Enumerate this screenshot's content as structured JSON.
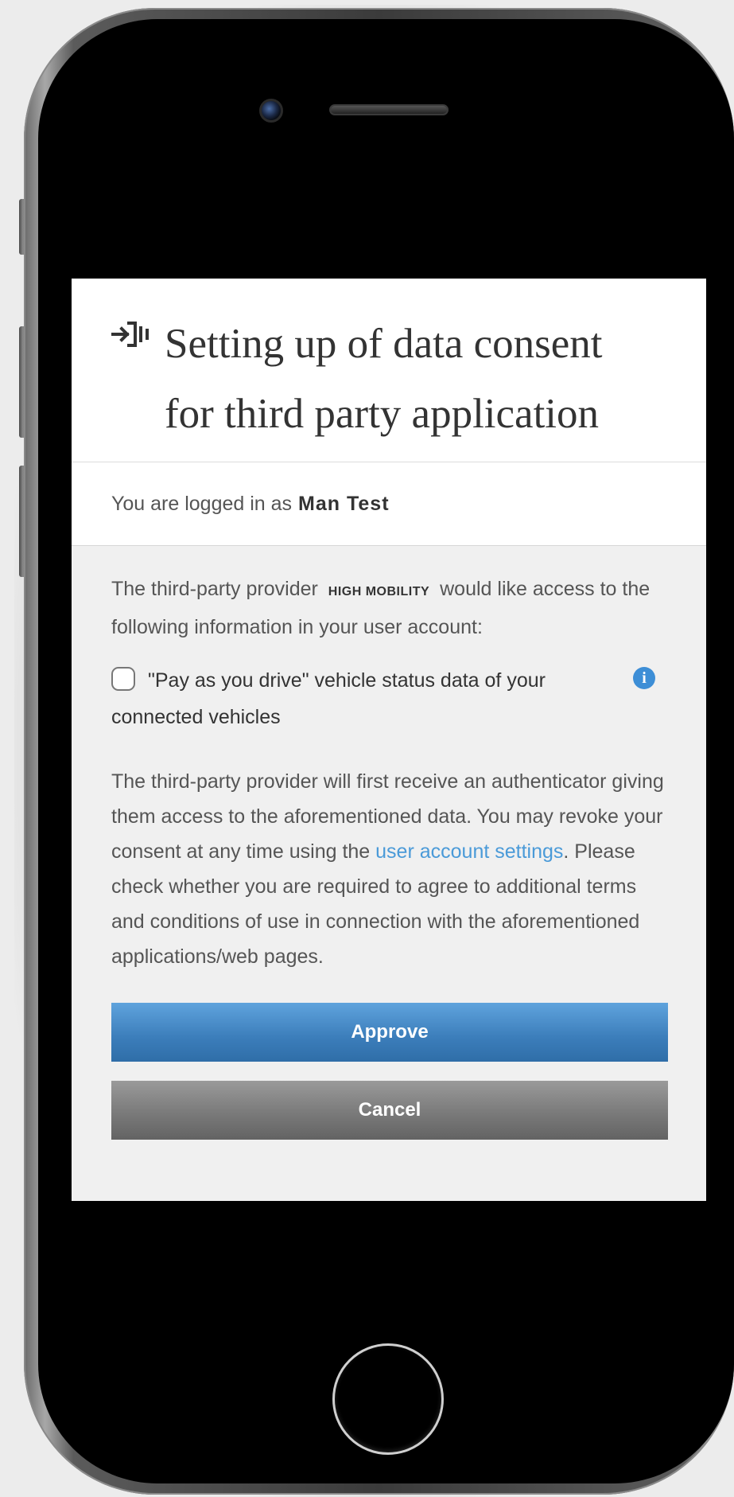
{
  "dialog": {
    "title_line1": "Setting up of data consent",
    "title_line2": "for third party application",
    "login_icon": "login-arrow-icon"
  },
  "account": {
    "logged_in_prefix": "You are logged in as",
    "user_name": "Man Test"
  },
  "intro": {
    "before_provider": "The third-party provider",
    "provider_name": "HIGH MOBILITY",
    "after_provider": "would like access to the following information in your user account:"
  },
  "consent_item": {
    "checked": false,
    "label": "\"Pay as you drive\" vehicle status data of your connected vehicles",
    "info_icon": "info-icon"
  },
  "details": {
    "part1": "The third-party provider will first receive an authenticator giving them access to the aforementioned data. You may revoke your consent at any time using the",
    "link_text": "user account settings",
    "part2": ". Please check whether you are required to agree to additional terms and conditions of use in connection with the aforementioned applications/web pages."
  },
  "buttons": {
    "approve_label": "Approve",
    "cancel_label": "Cancel"
  },
  "colors": {
    "accent_blue": "#3b7dba",
    "link_blue": "#4a9ad8",
    "cancel_gray": "#7a7a7a",
    "panel_bg": "#f0f0f0"
  }
}
